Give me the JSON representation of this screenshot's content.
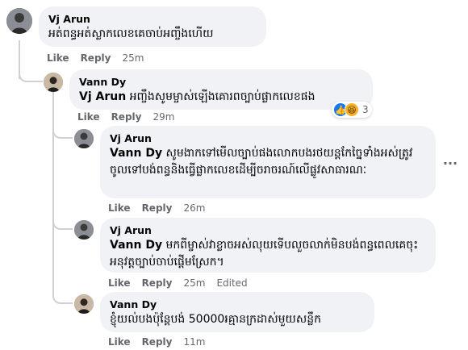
{
  "comments": [
    {
      "author": "Vj Arun",
      "text": "អត់ពន្ធអត់ស្លាកលេខគេចាប់អញ្ចឹងហើយ",
      "like": "Like",
      "reply": "Reply",
      "time": "25m"
    },
    {
      "author": "Vann Dy",
      "mention": "Vj Arun",
      "text": " អញ្ចឹងសូមម្ចាស់ឡើងគោរពច្បាប់ផ្លាកលេខផង",
      "like": "Like",
      "reply": "Reply",
      "time": "29m",
      "reactions": {
        "icons": [
          "like-icon",
          "haha-icon"
        ],
        "count": "3"
      }
    },
    {
      "author": "Vj Arun",
      "mention": "Vann Dy",
      "text": " សូមងាកទៅមើលច្បាប់ផងលោកបងរថយន្តកែច្នៃទាំងអស់ត្រូវចូលទៅបង់ពន្ធនិងធ្វើផ្លាកលេខដើម្បីចរាចរណ៍លើផ្លូវសាធារណៈ",
      "like": "Like",
      "reply": "Reply",
      "time": "26m",
      "more_icon": "more-horizontal-icon"
    },
    {
      "author": "Vj Arun",
      "mention": "Vann Dy",
      "text": " មកពីម្ចាស់វាខ្លាចអស់លុយទើបលួចលាក់មិនបង់ពន្ធពេលគេចុះអនុវត្តច្បាប់ចាប់ផ្តើមស្រែក។",
      "like": "Like",
      "reply": "Reply",
      "time": "25m",
      "edited": "Edited"
    },
    {
      "author": "Vann Dy",
      "text": "ខ្ញុំយល់បងប៉ុន្តែបង់ 50000៛គ្មានក្រដាស់មួយសន្លឹក",
      "like": "Like",
      "reply": "Reply",
      "time": "11m"
    }
  ],
  "colors": {
    "bubble": "#f0f2f5",
    "meta": "#65676b",
    "thread_line": "#ced0d4",
    "like_blue": "#1877f2",
    "haha_yellow": "#f7b125"
  }
}
